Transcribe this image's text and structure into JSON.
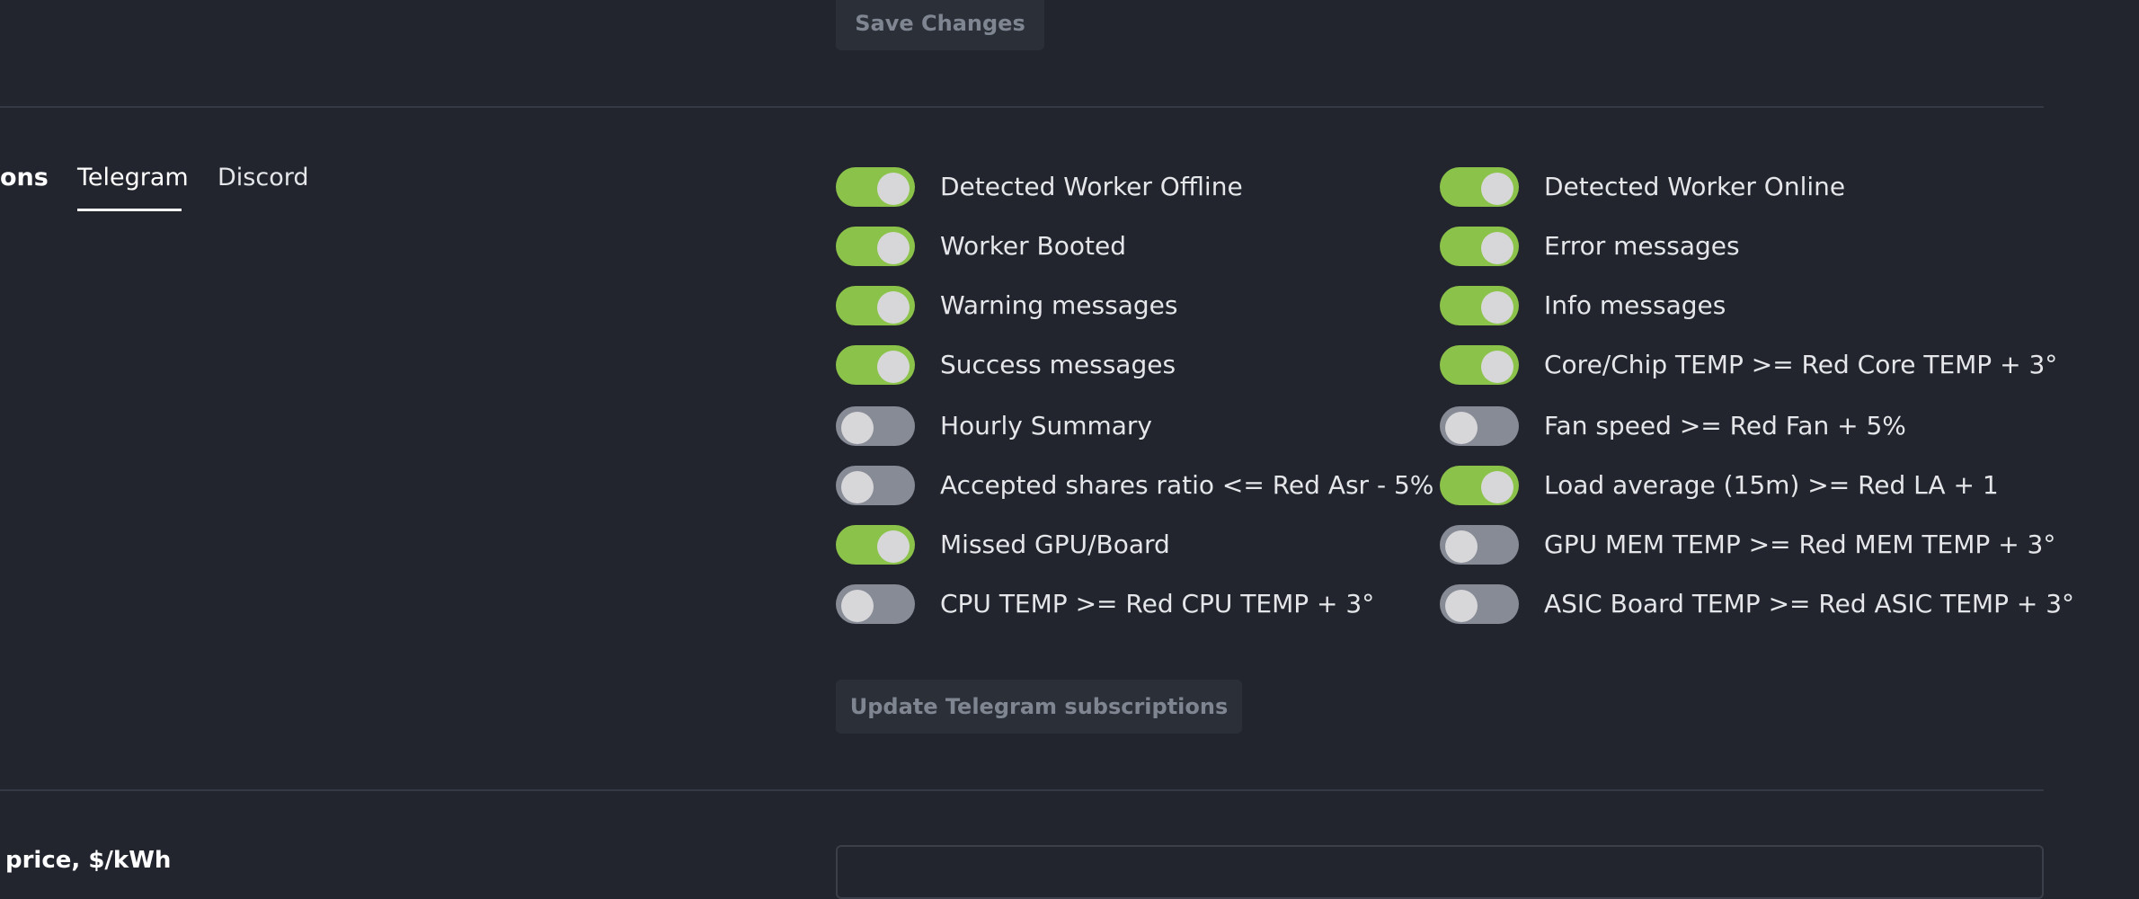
{
  "header": {
    "save_changes_label": "Save Changes"
  },
  "tabs": [
    {
      "label": "ons",
      "active": false
    },
    {
      "label": "Telegram",
      "active": true
    },
    {
      "label": "Discord",
      "active": false
    }
  ],
  "toggles": {
    "left": [
      {
        "label": "Detected Worker Offline",
        "enabled": true
      },
      {
        "label": "Worker Booted",
        "enabled": true
      },
      {
        "label": "Warning messages",
        "enabled": true
      },
      {
        "label": "Success messages",
        "enabled": true
      },
      {
        "label": "Hourly Summary",
        "enabled": false
      },
      {
        "label": "Accepted shares ratio <= Red Asr - 5%",
        "enabled": false
      },
      {
        "label": "Missed GPU/Board",
        "enabled": true
      },
      {
        "label": "CPU TEMP >= Red CPU TEMP + 3°",
        "enabled": false
      }
    ],
    "right": [
      {
        "label": "Detected Worker Online",
        "enabled": true
      },
      {
        "label": "Error messages",
        "enabled": true
      },
      {
        "label": "Info messages",
        "enabled": true
      },
      {
        "label": "Core/Chip TEMP >= Red Core TEMP + 3°",
        "enabled": true
      },
      {
        "label": "Fan speed >= Red Fan + 5%",
        "enabled": false
      },
      {
        "label": "Load average (15m) >= Red LA + 1",
        "enabled": true
      },
      {
        "label": "GPU MEM TEMP >= Red MEM TEMP + 3°",
        "enabled": false
      },
      {
        "label": "ASIC Board TEMP >= Red ASIC TEMP + 3°",
        "enabled": false
      }
    ]
  },
  "update_button_label": "Update Telegram subscriptions",
  "bottom": {
    "field_label": "y price, $/kWh"
  },
  "colors": {
    "background": "#22252d",
    "toggle_on": "#8bc34a",
    "toggle_off": "#868b96",
    "button_bg": "#2b2f38",
    "button_text": "#7f8691",
    "divider": "#353943"
  }
}
